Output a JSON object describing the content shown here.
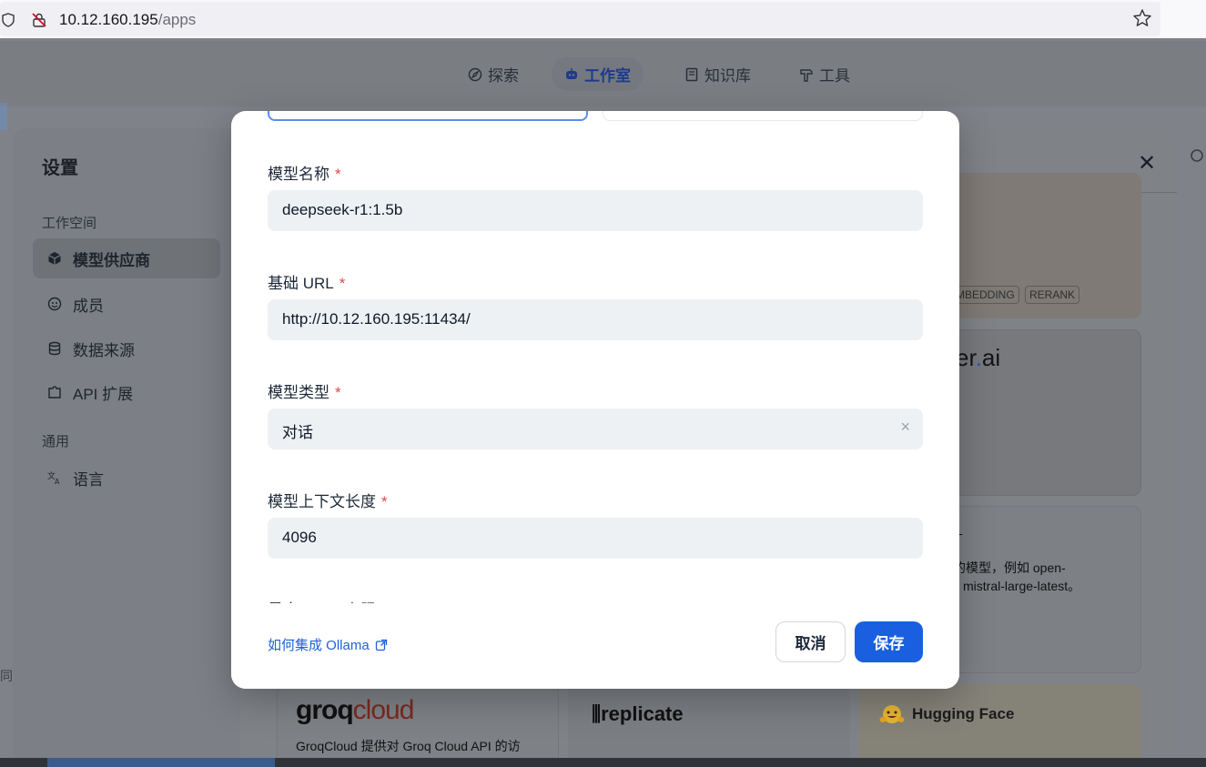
{
  "browser": {
    "url_host": "10.12.160.195",
    "url_path": "/apps"
  },
  "nav": {
    "explore": "探索",
    "studio": "工作室",
    "knowledge": "知识库",
    "tools": "工具"
  },
  "settings": {
    "title": "设置",
    "group_workspace": "工作空间",
    "group_general": "通用",
    "items": [
      {
        "label": "模型供应商",
        "icon": "cube-icon",
        "active": true
      },
      {
        "label": "成员",
        "icon": "members-icon",
        "active": false
      },
      {
        "label": "数据来源",
        "icon": "database-icon",
        "active": false
      },
      {
        "label": "API 扩展",
        "icon": "puzzle-icon",
        "active": false
      },
      {
        "label": "语言",
        "icon": "translate-icon",
        "active": false
      }
    ]
  },
  "providers": {
    "tags": [
      "MBEDDING",
      "RERANK"
    ],
    "cohere_a": "er",
    "cohere_dot": ".",
    "cohere_b": "ai",
    "mistral_line1": "共的模型，例如 open-",
    "mistral_line2": "mistral-large-latest。",
    "mistral_title_frag": "L",
    "groq_a": "groq",
    "groq_b": "cloud",
    "groq_desc": "GroqCloud 提供对 Groq Cloud API 的访",
    "replicate": "replicate",
    "huggingface": "Hugging Face",
    "left_frag": "同"
  },
  "modal": {
    "fields": [
      {
        "label": "模型名称",
        "value": "deepseek-r1:1.5b"
      },
      {
        "label": "基础 URL",
        "value": "http://10.12.160.195:11434/"
      },
      {
        "label": "模型类型",
        "value": "对话"
      },
      {
        "label": "模型上下文长度",
        "value": "4096"
      }
    ],
    "cut_label": "最大 token 上限",
    "required_mark": "*",
    "clear_mark": "×",
    "help_link": "如何集成 Ollama",
    "cancel": "取消",
    "save": "保存"
  },
  "colors": {
    "primary": "#1a5fe0",
    "required": "#e04747",
    "link": "#1f61d8"
  }
}
